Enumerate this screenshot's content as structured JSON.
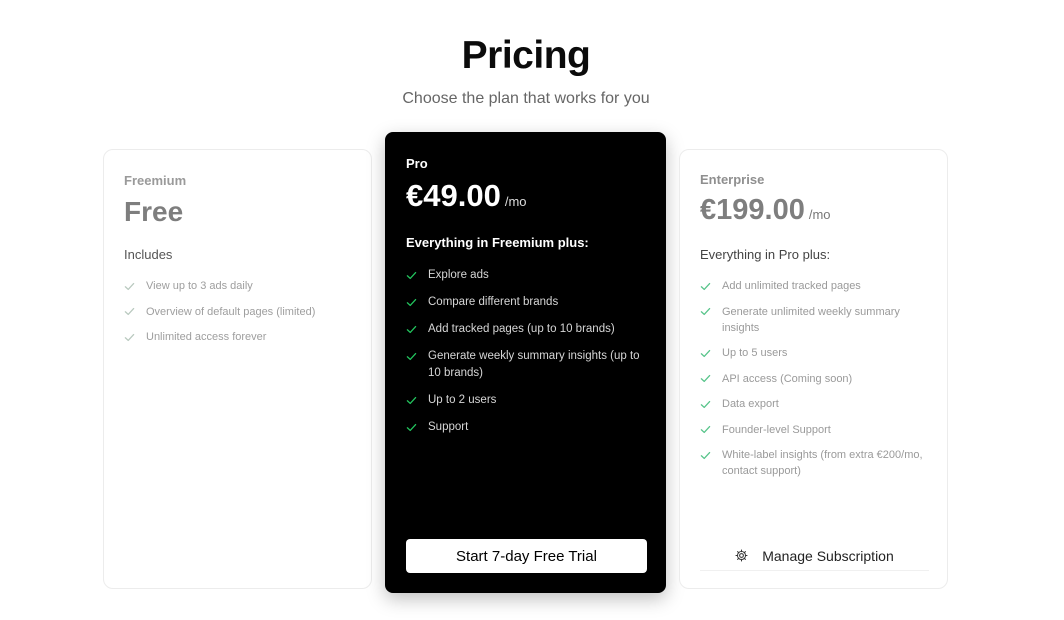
{
  "header": {
    "title": "Pricing",
    "subtitle": "Choose the plan that works for you"
  },
  "plans": [
    {
      "name": "Freemium",
      "price": "Free",
      "includes": "Includes",
      "features": [
        "View up to 3 ads daily",
        "Overview of default pages (limited)",
        "Unlimited access forever"
      ]
    },
    {
      "name": "Pro",
      "price": "€49.00",
      "period": "/mo",
      "includes": "Everything in Freemium plus:",
      "features": [
        "Explore ads",
        "Compare different brands",
        "Add tracked pages (up to 10 brands)",
        "Generate weekly summary insights (up to 10 brands)",
        "Up to 2 users",
        "Support"
      ],
      "cta": "Start 7-day Free Trial",
      "highlight": true
    },
    {
      "name": "Enterprise",
      "price": "€199.00",
      "period": "/mo",
      "includes": "Everything in Pro plus:",
      "features": [
        "Add unlimited tracked pages",
        "Generate unlimited weekly summary insights",
        "Up to 5 users",
        "API access (Coming soon)",
        "Data export",
        "Founder-level Support",
        "White-label insights (from extra €200/mo, contact support)"
      ],
      "cta": "Manage Subscription",
      "cta_icon": "gear-icon"
    }
  ],
  "colors": {
    "pro_background": "#000000",
    "check_green": "#22c55e",
    "page_background": "#ffffff"
  }
}
